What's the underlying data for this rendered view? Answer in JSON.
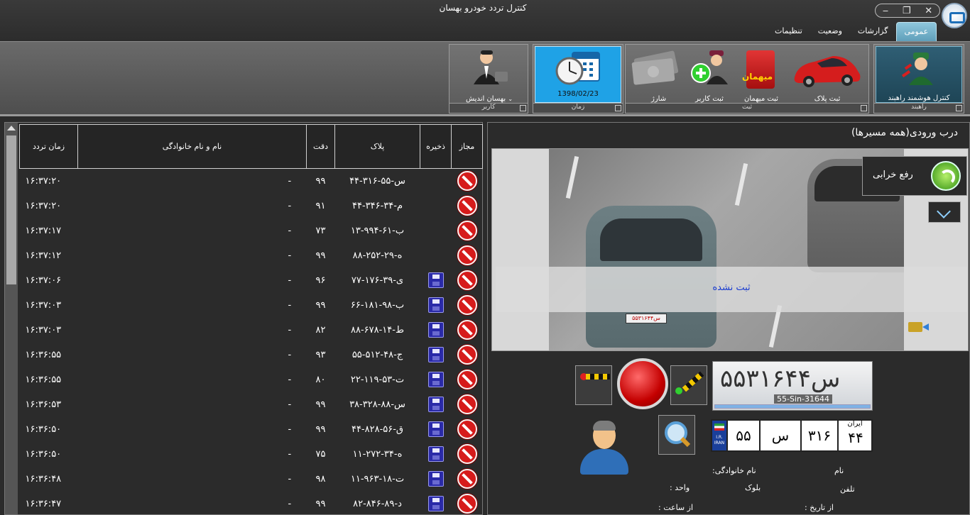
{
  "window": {
    "title": "کنترل تردد خودرو بهسان",
    "controls": [
      "‒",
      "❐",
      "✕"
    ]
  },
  "tabs": [
    {
      "label": "عمومی",
      "active": true
    },
    {
      "label": "گزارشات",
      "active": false
    },
    {
      "label": "وضعیت",
      "active": false
    },
    {
      "label": "تنظیمات",
      "active": false
    }
  ],
  "ribbon": {
    "gate_group": {
      "label": "راهبند",
      "smart_control": "کنترل هوشمند راهبند"
    },
    "register_group": {
      "label": "ثبت",
      "plate": "ثبت پلاک",
      "guest": "ثبت میهمان",
      "guest_tag": "میهمان",
      "user": "ثبت کاربر",
      "charge": "شارژ"
    },
    "time_group": {
      "label": "زمان",
      "date": "1398/02/23"
    },
    "user_group": {
      "label": "کاربر",
      "user_name": "بهسان اندیش"
    }
  },
  "table": {
    "headers": {
      "allow": "مجاز",
      "save": "ذخیره",
      "plate": "پلاک",
      "accuracy": "دقت",
      "name": "نام و نام خانوادگی",
      "time": "زمان تردد"
    },
    "rows": [
      {
        "time": "۱۶:۳۷:۲۰",
        "name": "-",
        "accuracy": "۹۹",
        "plate": "۴۴-۳۱۶-س-۵۵",
        "saved": false
      },
      {
        "time": "۱۶:۳۷:۲۰",
        "name": "-",
        "accuracy": "۹۱",
        "plate": "۴۴-۳۴۶-م-۳۴",
        "saved": false
      },
      {
        "time": "۱۶:۳۷:۱۷",
        "name": "-",
        "accuracy": "۷۳",
        "plate": "۱۳-۹۹۴-ب-۶۱",
        "saved": false
      },
      {
        "time": "۱۶:۳۷:۱۲",
        "name": "-",
        "accuracy": "۹۹",
        "plate": "۸۸-۲۵۲-ه-۲۹",
        "saved": false
      },
      {
        "time": "۱۶:۳۷:۰۶",
        "name": "-",
        "accuracy": "۹۶",
        "plate": "۷۷-۱۷۶-ی-۳۹",
        "saved": true
      },
      {
        "time": "۱۶:۳۷:۰۳",
        "name": "-",
        "accuracy": "۹۹",
        "plate": "۶۶-۱۸۱-ب-۹۸",
        "saved": true
      },
      {
        "time": "۱۶:۳۷:۰۳",
        "name": "-",
        "accuracy": "۸۲",
        "plate": "۸۸-۶۷۸-ط-۱۴",
        "saved": true
      },
      {
        "time": "۱۶:۳۶:۵۵",
        "name": "-",
        "accuracy": "۹۳",
        "plate": "۵۵-۵۱۲-ج-۴۸",
        "saved": true
      },
      {
        "time": "۱۶:۳۶:۵۵",
        "name": "-",
        "accuracy": "۸۰",
        "plate": "۲۲-۱۱۹-ت-۵۳",
        "saved": true
      },
      {
        "time": "۱۶:۳۶:۵۳",
        "name": "-",
        "accuracy": "۹۹",
        "plate": "۳۸-۳۲۸-س-۸۸",
        "saved": true
      },
      {
        "time": "۱۶:۳۶:۵۰",
        "name": "-",
        "accuracy": "۹۹",
        "plate": "۴۴-۸۲۸-ق-۵۶",
        "saved": true
      },
      {
        "time": "۱۶:۳۶:۵۰",
        "name": "-",
        "accuracy": "۷۵",
        "plate": "۱۱-۲۷۲-ه-۳۴",
        "saved": true
      },
      {
        "time": "۱۶:۳۶:۴۸",
        "name": "-",
        "accuracy": "۹۸",
        "plate": "۱۱-۹۶۳-ت-۱۸",
        "saved": true
      },
      {
        "time": "۱۶:۳۶:۴۷",
        "name": "-",
        "accuracy": "۹۹",
        "plate": "۸۲-۸۴۶-د-۸۹",
        "saved": true
      }
    ]
  },
  "camera": {
    "title": "درب ورودی(همه مسیرها)",
    "status": "ثبت نشده",
    "repair_label": "رفع خرابی",
    "car_plate_text": "۵۵س۳۱۶۴۴"
  },
  "plate_reader": {
    "crop_text": "۵۵س۳۱۶۴۴",
    "latin": "55-Sin-31644",
    "progress": 1.0,
    "part1": "۵۵",
    "letter": "س",
    "part3": "۳۱۶",
    "region": "۴۴",
    "country": "ایران",
    "flag_text": "I.R. IRAN"
  },
  "driver_info": {
    "name": "نام",
    "full_name": "نام خانوادگی:",
    "phone": "تلفن",
    "block": "بلوک",
    "unit": "واحد :",
    "from_date": "از تاریخ :",
    "from_time": "از ساعت :"
  }
}
